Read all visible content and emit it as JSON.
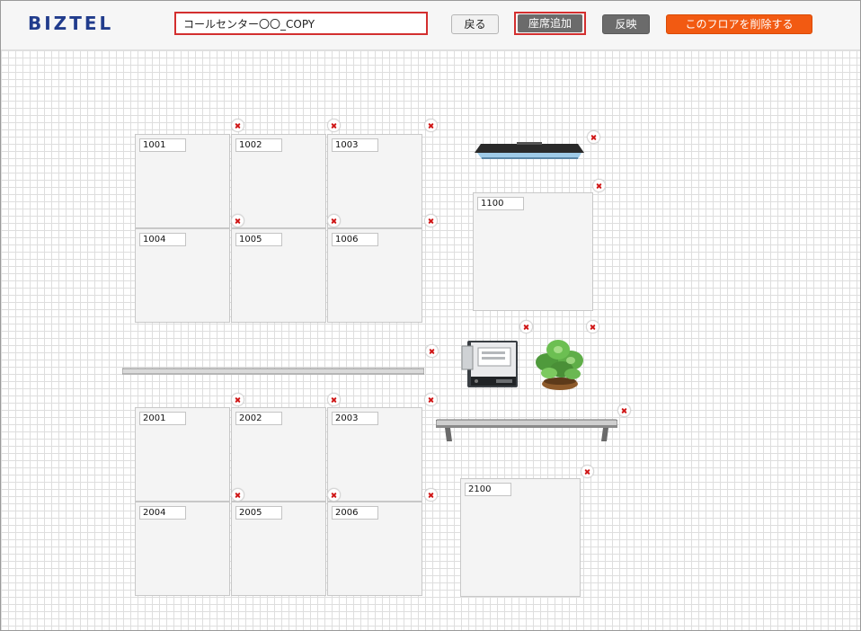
{
  "header": {
    "logo": "BIZTEL",
    "floor_name": "コールセンター〇〇_COPY",
    "back_label": "戻る",
    "add_seat_label": "座席追加",
    "apply_label": "反映",
    "delete_floor_label": "このフロアを削除する"
  },
  "seats": [
    {
      "label": "1001"
    },
    {
      "label": "1002"
    },
    {
      "label": "1003"
    },
    {
      "label": "1004"
    },
    {
      "label": "1005"
    },
    {
      "label": "1006"
    },
    {
      "label": "1100"
    },
    {
      "label": "2001"
    },
    {
      "label": "2002"
    },
    {
      "label": "2003"
    },
    {
      "label": "2004"
    },
    {
      "label": "2005"
    },
    {
      "label": "2006"
    },
    {
      "label": "2100"
    }
  ],
  "objects": [
    "monitor-icon",
    "copier-icon",
    "plant-icon",
    "partition-icon",
    "shelf-icon"
  ],
  "colors": {
    "accent": "#f25a12",
    "delete_mark": "#d01818",
    "logo": "#213c8c"
  }
}
